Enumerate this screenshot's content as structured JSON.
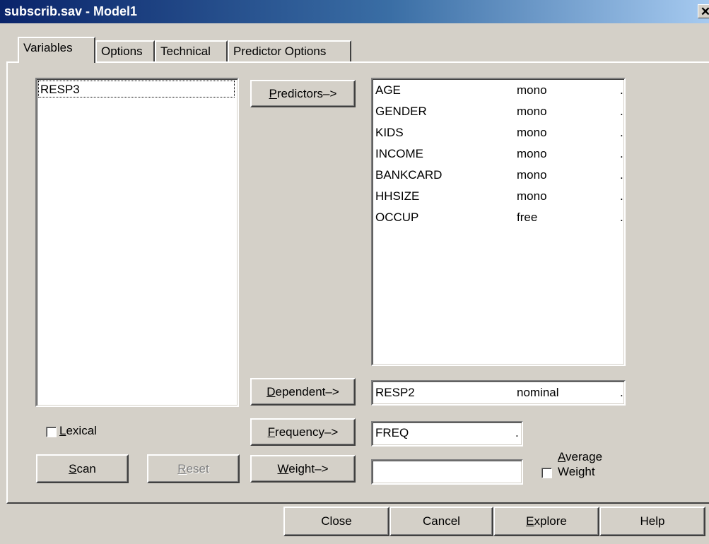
{
  "window": {
    "title": "subscrib.sav - Model1",
    "close_glyph": "✕"
  },
  "tabs": [
    {
      "label": "Variables"
    },
    {
      "label": "Options"
    },
    {
      "label": "Technical"
    },
    {
      "label": "Predictor Options"
    }
  ],
  "source_list": {
    "items": [
      "RESP3"
    ]
  },
  "predictors_button": {
    "accel": "P",
    "rest": "redictors–>"
  },
  "predictors": [
    {
      "name": "AGE",
      "level": "mono",
      "dot": "."
    },
    {
      "name": "GENDER",
      "level": "mono",
      "dot": "."
    },
    {
      "name": "KIDS",
      "level": "mono",
      "dot": "."
    },
    {
      "name": "INCOME",
      "level": "mono",
      "dot": "."
    },
    {
      "name": "BANKCARD",
      "level": "mono",
      "dot": "."
    },
    {
      "name": "HHSIZE",
      "level": "mono",
      "dot": "."
    },
    {
      "name": "OCCUP",
      "level": "free",
      "dot": "."
    }
  ],
  "dependent_button": {
    "accel": "D",
    "rest": "ependent–>"
  },
  "dependent": {
    "name": "RESP2",
    "level": "nominal",
    "dot": "."
  },
  "frequency_button": {
    "accel": "F",
    "rest": "requency–>"
  },
  "frequency": {
    "name": "FREQ",
    "dot": "."
  },
  "weight_button": {
    "accel": "W",
    "rest": "eight–>"
  },
  "weight": {
    "value": ""
  },
  "average_weight": {
    "line1_accel": "A",
    "line1_rest": "verage",
    "line2": "Weight",
    "checked": false
  },
  "lexical": {
    "accel": "L",
    "rest": "exical",
    "checked": false
  },
  "scan_button": {
    "accel": "S",
    "rest": "can"
  },
  "reset_button": {
    "accel": "R",
    "rest": "eset",
    "enabled": false
  },
  "bottom_buttons": {
    "close": "Close",
    "cancel": "Cancel",
    "explore_accel": "E",
    "explore_rest": "xplore",
    "help": "Help"
  }
}
